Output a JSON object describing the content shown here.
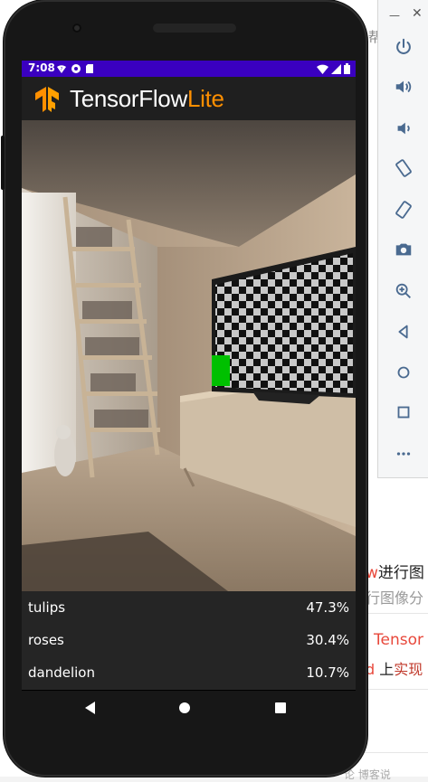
{
  "status_bar": {
    "time": "7:08",
    "left_icons": [
      "wifi-question-icon",
      "data-saver-icon",
      "sd-card-icon"
    ],
    "right_icons": [
      "wifi-icon",
      "cell-signal-icon",
      "battery-icon"
    ],
    "color": "#3a00c0"
  },
  "app_bar": {
    "title_main": "TensorFlow",
    "title_accent": "Lite",
    "accent_color": "#ff8f00"
  },
  "results": [
    {
      "label": "tulips",
      "score": "47.3%"
    },
    {
      "label": "roses",
      "score": "30.4%"
    },
    {
      "label": "dandelion",
      "score": "10.7%"
    }
  ],
  "nav_bar": {
    "buttons": [
      "back-icon",
      "home-icon",
      "recents-icon"
    ]
  },
  "emulator_toolbar": {
    "top_controls": [
      "minimize-icon",
      "close-icon"
    ],
    "buttons": [
      "power-icon",
      "volume-up-icon",
      "volume-down-icon",
      "rotate-left-icon",
      "rotate-right-icon",
      "camera-icon",
      "zoom-icon",
      "back-icon",
      "home-icon",
      "overview-icon",
      "more-icon"
    ]
  },
  "background_page": {
    "fragment_1_accent": "w",
    "fragment_1_text": "进行图",
    "fragment_2_text": "行图像分",
    "fragment_3_accent": "Tensor",
    "fragment_4_accent": "d",
    "fragment_4_text": "上",
    "fragment_4_link": "实现",
    "fragment_top": "帮",
    "fragment_bottom": "论 博客说"
  }
}
